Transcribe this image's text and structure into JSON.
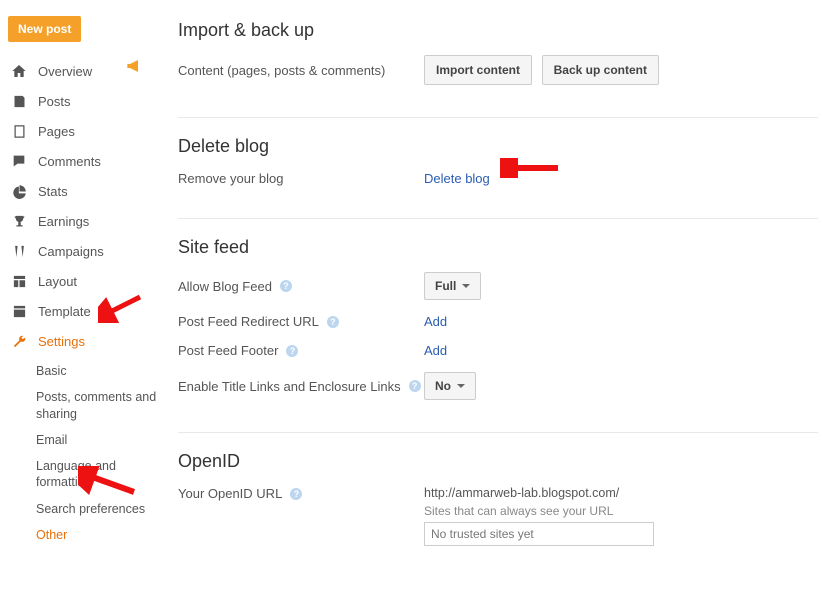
{
  "newPost": "New post",
  "nav": {
    "overview": "Overview",
    "posts": "Posts",
    "pages": "Pages",
    "comments": "Comments",
    "stats": "Stats",
    "earnings": "Earnings",
    "campaigns": "Campaigns",
    "layout": "Layout",
    "template": "Template",
    "settings": "Settings"
  },
  "sub": {
    "basic": "Basic",
    "postsComments": "Posts, comments and sharing",
    "email": "Email",
    "lang": "Language and formatting",
    "search": "Search preferences",
    "other": "Other"
  },
  "sections": {
    "importBackup": {
      "title": "Import & back up",
      "desc": "Content (pages, posts & comments)",
      "importBtn": "Import content",
      "backupBtn": "Back up content"
    },
    "deleteBlog": {
      "title": "Delete blog",
      "desc": "Remove your blog",
      "link": "Delete blog"
    },
    "siteFeed": {
      "title": "Site feed",
      "allow": "Allow Blog Feed",
      "allowValue": "Full",
      "redirect": "Post Feed Redirect URL",
      "redirectLink": "Add",
      "footer": "Post Feed Footer",
      "footerLink": "Add",
      "enableLinks": "Enable Title Links and Enclosure Links",
      "enableValue": "No"
    },
    "openid": {
      "title": "OpenID",
      "label": "Your OpenID URL",
      "url": "http://ammarweb-lab.blogspot.com/",
      "sub": "Sites that can always see your URL",
      "box": "No trusted sites yet"
    }
  }
}
